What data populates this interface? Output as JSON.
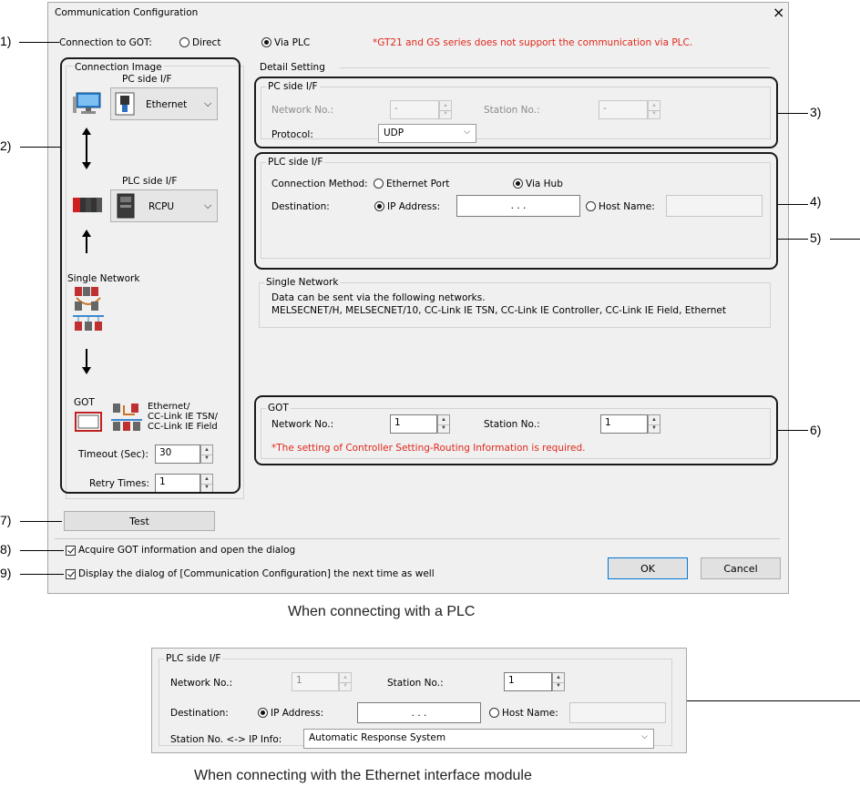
{
  "dialog": {
    "title": "Communication Configuration",
    "close_glyph": "×",
    "connection_to_got_label": "Connection to GOT:",
    "radio_direct": "Direct",
    "radio_via_plc": "Via PLC",
    "note_via_plc": "*GT21 and GS series does not support the communication via PLC.",
    "connection_image": {
      "title": "Connection Image",
      "pc_side_if_label": "PC side I/F",
      "pc_side_if_value": "Ethernet",
      "plc_side_if_label": "PLC side I/F",
      "plc_side_if_value": "RCPU",
      "single_network_label": "Single Network",
      "got_label": "GOT",
      "got_if_text": [
        "Ethernet/",
        "CC-Link IE TSN/",
        "CC-Link IE Field"
      ],
      "timeout_label": "Timeout (Sec):",
      "timeout_value": "30",
      "retry_label": "Retry Times:",
      "retry_value": "1"
    },
    "detail_setting": {
      "title": "Detail Setting",
      "pc_side": {
        "title": "PC side I/F",
        "network_no_label": "Network No.:",
        "network_no_value": "-",
        "station_no_label": "Station No.:",
        "station_no_value": "-",
        "protocol_label": "Protocol:",
        "protocol_value": "UDP"
      },
      "plc_side": {
        "title": "PLC side I/F",
        "connection_method_label": "Connection Method:",
        "radio_ethernet_port": "Ethernet Port",
        "radio_via_hub": "Via Hub",
        "destination_label": "Destination:",
        "radio_ip_address": "IP Address:",
        "ip_value": ".      .      .",
        "radio_host_name": "Host Name:",
        "host_value": ""
      },
      "single_network": {
        "title": "Single Network",
        "line1": "Data can be sent via the following networks.",
        "line2": "MELSECNET/H, MELSECNET/10, CC-Link IE TSN, CC-Link IE Controller, CC-Link IE Field, Ethernet"
      },
      "got": {
        "title": "GOT",
        "network_no_label": "Network No.:",
        "network_no_value": "1",
        "station_no_label": "Station No.:",
        "station_no_value": "1",
        "note": "*The setting of Controller Setting-Routing Information is required."
      }
    },
    "test_button": "Test",
    "acquire_checkbox": "Acquire GOT information and open the dialog",
    "display_checkbox": "Display the dialog of [Communication Configuration] the next time as well",
    "ok_button": "OK",
    "cancel_button": "Cancel"
  },
  "annotations": {
    "a1": "1)",
    "a2": "2)",
    "a3": "3)",
    "a4": "4)",
    "a5": "5)",
    "a6": "6)",
    "a7": "7)",
    "a8": "8)",
    "a9": "9)"
  },
  "caption1": "When connecting with a PLC",
  "dialog2": {
    "title": "PLC side I/F",
    "network_no_label": "Network No.:",
    "network_no_value": "1",
    "station_no_label": "Station No.:",
    "station_no_value": "1",
    "destination_label": "Destination:",
    "radio_ip_address": "IP Address:",
    "ip_value": ".      .      .",
    "radio_host_name": "Host Name:",
    "host_value": "",
    "station_ip_label": "Station No. <-> IP Info:",
    "station_ip_value": "Automatic Response System"
  },
  "caption2": "When connecting with the Ethernet interface module"
}
